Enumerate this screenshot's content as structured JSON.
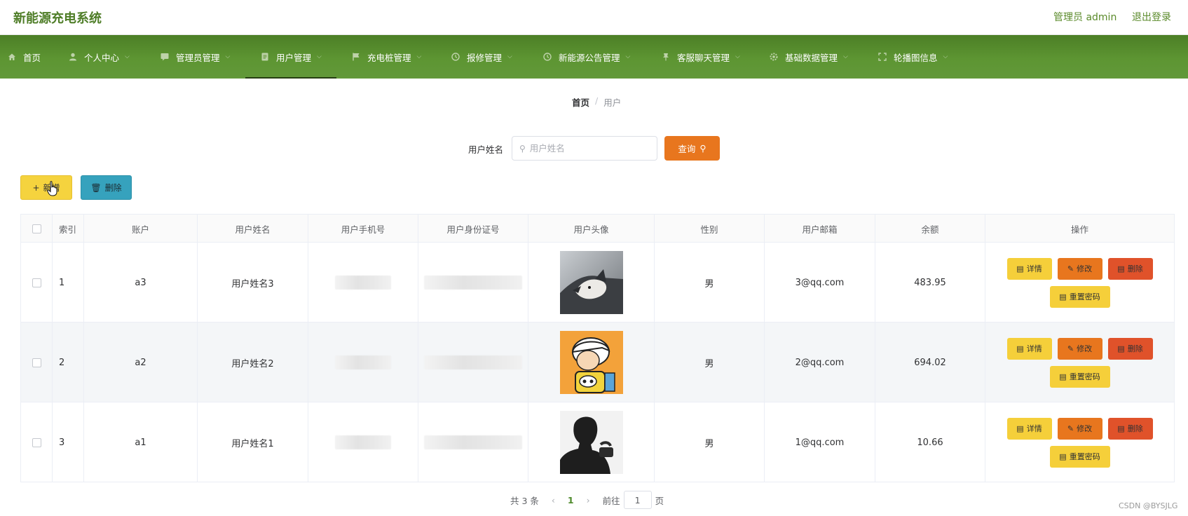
{
  "header": {
    "title": "新能源充电系统",
    "admin": "管理员 admin",
    "logout": "退出登录"
  },
  "nav": {
    "items": [
      {
        "label": "首页",
        "icon": "home-icon"
      },
      {
        "label": "个人中心",
        "icon": "user-icon"
      },
      {
        "label": "管理员管理",
        "icon": "chat-icon"
      },
      {
        "label": "用户管理",
        "icon": "document-icon"
      },
      {
        "label": "充电桩管理",
        "icon": "flag-icon"
      },
      {
        "label": "报修管理",
        "icon": "clock-icon"
      },
      {
        "label": "新能源公告管理",
        "icon": "clock-icon"
      },
      {
        "label": "客服聊天管理",
        "icon": "pin-icon"
      },
      {
        "label": "基础数据管理",
        "icon": "gear-icon"
      },
      {
        "label": "轮播图信息",
        "icon": "expand-icon"
      }
    ]
  },
  "breadcrumb": {
    "home": "首页",
    "separator": "/",
    "current": "用户"
  },
  "search": {
    "label": "用户姓名",
    "placeholder": "用户姓名",
    "button": "查询"
  },
  "actions": {
    "add": "新增",
    "delete": "删除"
  },
  "table": {
    "headers": [
      "索引",
      "账户",
      "用户姓名",
      "用户手机号",
      "用户身份证号",
      "用户头像",
      "性别",
      "用户邮箱",
      "余额",
      "操作"
    ],
    "rows": [
      {
        "index": "1",
        "account": "a3",
        "name": "用户姓名3",
        "avatar": "husky-photo",
        "gender": "男",
        "email": "3@qq.com",
        "balance": "483.95"
      },
      {
        "index": "2",
        "account": "a2",
        "name": "用户姓名2",
        "avatar": "cartoon-boy",
        "gender": "男",
        "email": "2@qq.com",
        "balance": "694.02"
      },
      {
        "index": "3",
        "account": "a1",
        "name": "用户姓名1",
        "avatar": "man-silhouette",
        "gender": "男",
        "email": "1@qq.com",
        "balance": "10.66"
      }
    ],
    "row_actions": {
      "detail": "详情",
      "edit": "修改",
      "remove": "删除",
      "reset": "重置密码"
    }
  },
  "pagination": {
    "total": "共 3 条",
    "current": "1",
    "goto_prefix": "前往",
    "goto_value": "1",
    "goto_suffix": "页"
  },
  "watermark": "CSDN @BYSJLG",
  "colors": {
    "nav": "#5a8f30",
    "query": "#e8761e",
    "add": "#f5d33e",
    "delete": "#36a2bd",
    "edit": "#e8761e",
    "remove": "#e0522a"
  }
}
